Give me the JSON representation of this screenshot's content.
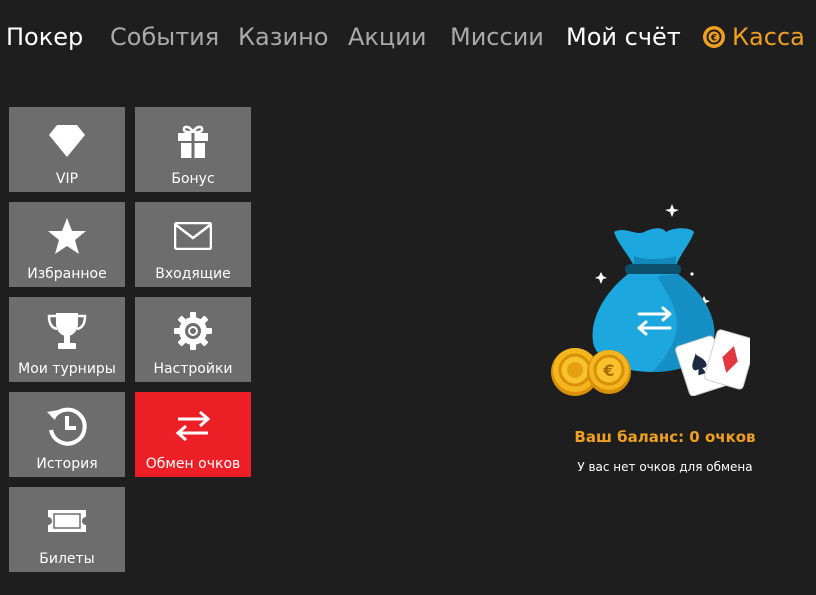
{
  "nav": {
    "poker": "Покер",
    "events": "События",
    "casino": "Казино",
    "promotions": "Акции",
    "missions": "Миссии",
    "account": "Мой счёт",
    "cashier": "Касса"
  },
  "menu": [
    {
      "label": "VIP",
      "icon": "diamond-icon"
    },
    {
      "label": "Бонус",
      "icon": "gift-icon"
    },
    {
      "label": "Избранное",
      "icon": "star-icon"
    },
    {
      "label": "Входящие",
      "icon": "envelope-icon"
    },
    {
      "label": "Мои турниры",
      "icon": "trophy-icon"
    },
    {
      "label": "Настройки",
      "icon": "gear-icon"
    },
    {
      "label": "История",
      "icon": "history-icon"
    },
    {
      "label": "Обмен очков",
      "icon": "exchange-icon",
      "active": true
    },
    {
      "label": "Билеты",
      "icon": "ticket-icon"
    }
  ],
  "main": {
    "balance": "Ваш баланс: 0 очков",
    "note": "У вас нет очков для обмена"
  },
  "colors": {
    "background": "#1e1e1e",
    "tile": "#6d6d6d",
    "active_tile": "#ec1f27",
    "accent": "#f0a020"
  }
}
